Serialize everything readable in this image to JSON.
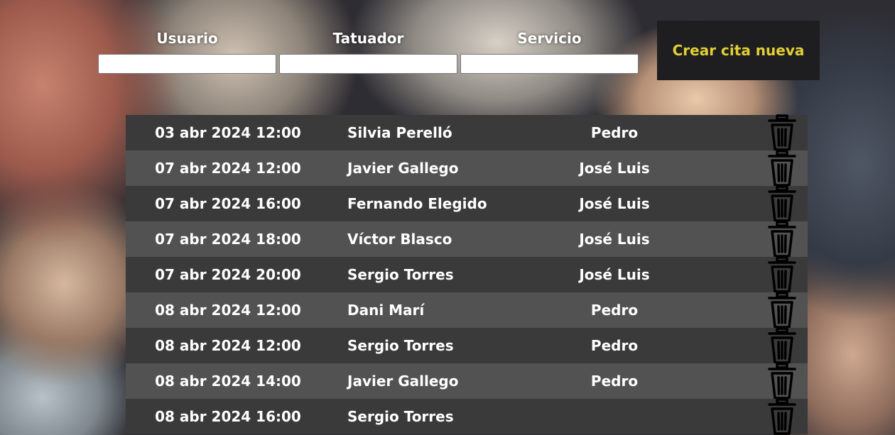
{
  "filters": {
    "user_label": "Usuario",
    "user_value": "",
    "artist_label": "Tatuador",
    "artist_value": "",
    "service_label": "Servicio",
    "service_value": ""
  },
  "create_button_label": "Crear cita nueva",
  "appointments": [
    {
      "date": "03 abr 2024 12:00",
      "client": "Silvia Perelló",
      "artist": "Pedro"
    },
    {
      "date": "07 abr 2024 12:00",
      "client": "Javier Gallego",
      "artist": "José Luis"
    },
    {
      "date": "07 abr 2024 16:00",
      "client": "Fernando Elegido",
      "artist": "José Luis"
    },
    {
      "date": "07 abr 2024 18:00",
      "client": "Víctor Blasco",
      "artist": "José Luis"
    },
    {
      "date": "07 abr 2024 20:00",
      "client": "Sergio Torres",
      "artist": "José Luis"
    },
    {
      "date": "08 abr 2024 12:00",
      "client": "Dani Marí",
      "artist": "Pedro"
    },
    {
      "date": "08 abr 2024 12:00",
      "client": "Sergio Torres",
      "artist": "Pedro"
    },
    {
      "date": "08 abr 2024 14:00",
      "client": "Javier Gallego",
      "artist": "Pedro"
    },
    {
      "date": "08 abr 2024 16:00",
      "client": "Sergio Torres",
      "artist": ""
    }
  ],
  "icons": {
    "delete": "trash-icon"
  },
  "colors": {
    "button_background": "#1e1e20",
    "button_text": "#e3cf34",
    "row_dark": "#3a3a3a",
    "row_light": "#525252"
  }
}
